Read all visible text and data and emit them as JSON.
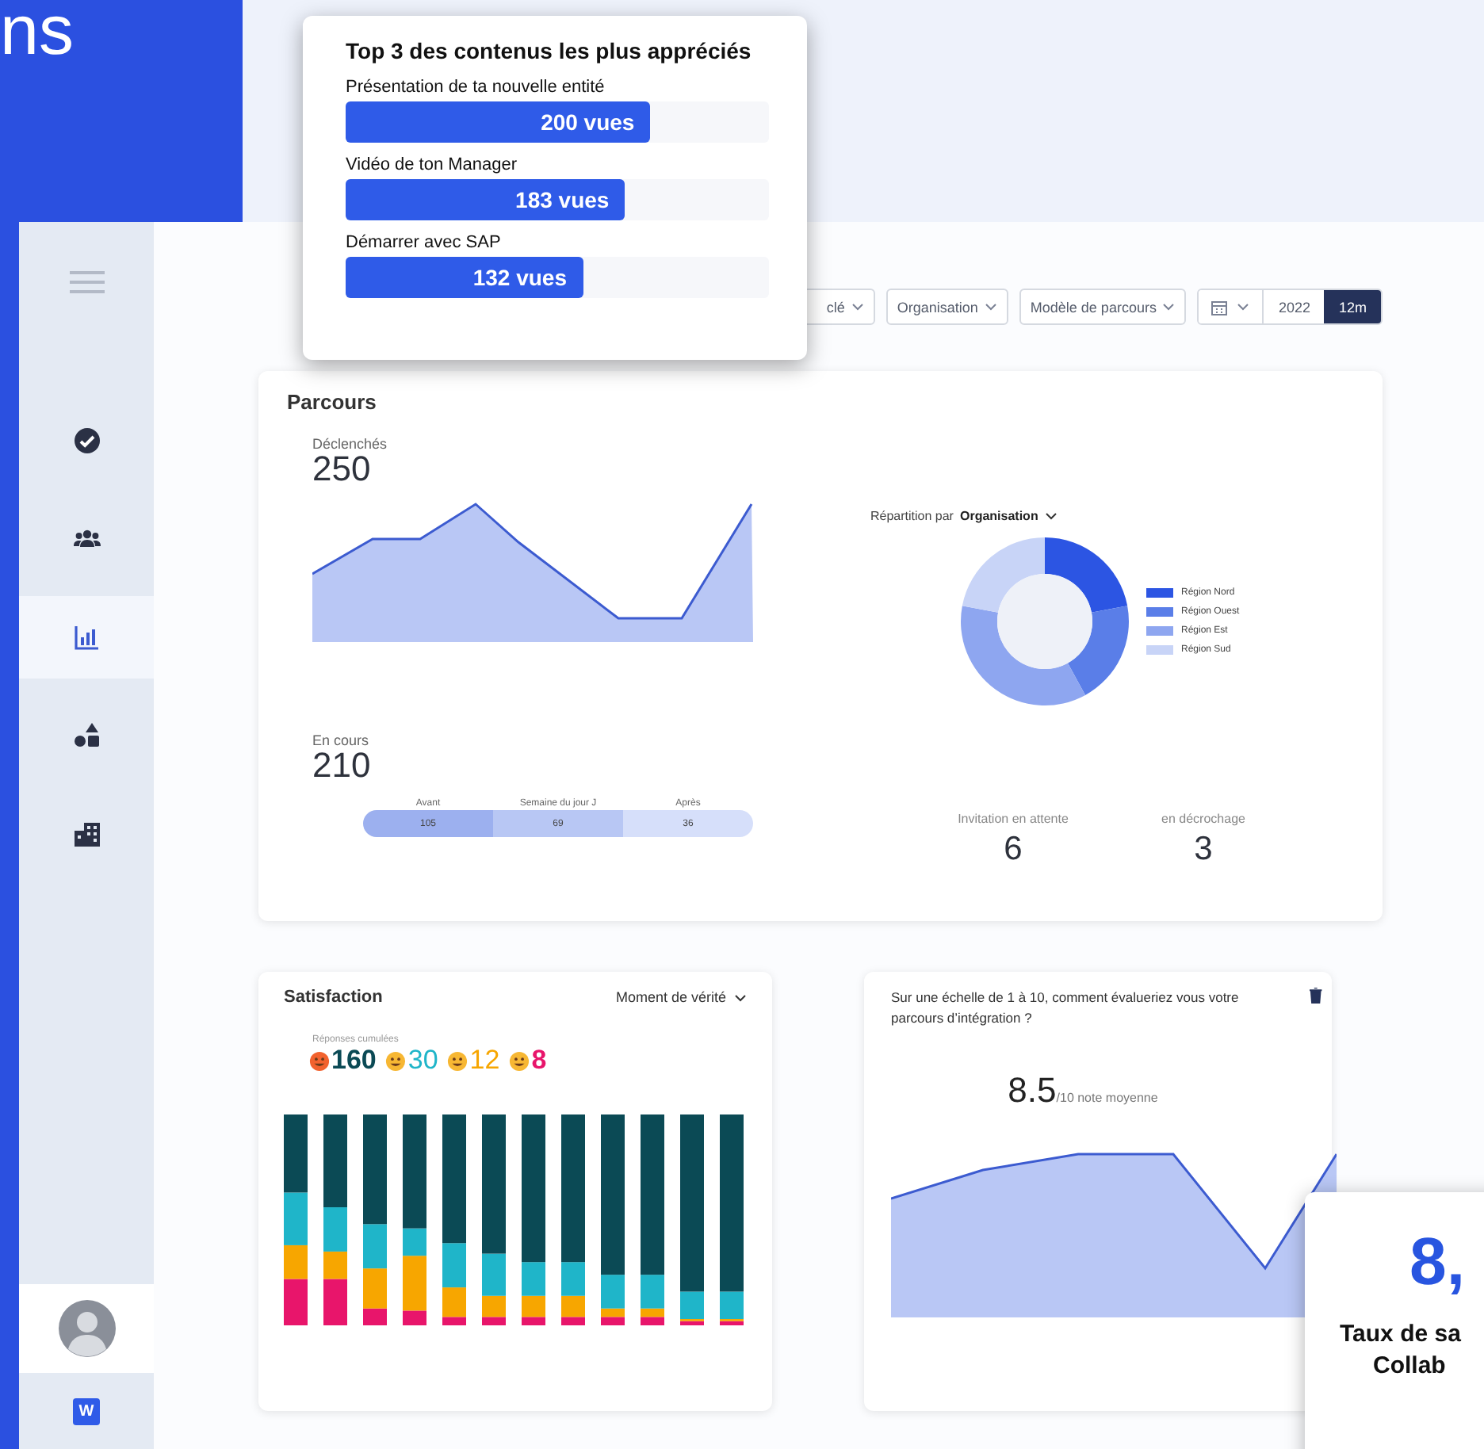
{
  "backdrop": {
    "heading_fragment": "ns"
  },
  "top_content": {
    "title": "Top 3 des contenus les plus appréciés",
    "items": [
      {
        "label": "Présentation de ta nouvelle entité",
        "value": "200 vues",
        "level": 0.72
      },
      {
        "label": "Vidéo de ton Manager",
        "value": "183 vues",
        "level": 0.66
      },
      {
        "label": "Démarrer avec SAP",
        "value": "132 vues",
        "level": 0.56
      }
    ]
  },
  "sidebar": {
    "items": [
      {
        "kind": "check",
        "selected": false
      },
      {
        "kind": "people",
        "selected": false
      },
      {
        "kind": "chart",
        "selected": true
      },
      {
        "kind": "shapes",
        "selected": false
      },
      {
        "kind": "building",
        "selected": false
      }
    ],
    "workspace_letter": "W"
  },
  "filters": {
    "chips": [
      "clé",
      "Organisation",
      "Modèle de parcours"
    ],
    "periods": [
      {
        "label": "2022",
        "selected": false
      },
      {
        "label": "12m",
        "selected": true
      }
    ]
  },
  "parcours": {
    "title": "Parcours",
    "triggered": {
      "label": "Déclenchés",
      "value": "250"
    },
    "breakdown": {
      "label": "Répartition par",
      "dimension": "Organisation",
      "legend": [
        {
          "label": "Région Nord",
          "color": "#2c55e3"
        },
        {
          "label": "Région Ouest",
          "color": "#5a7ee8"
        },
        {
          "label": "Région Est",
          "color": "#8ea6f0"
        },
        {
          "label": "Région Sud",
          "color": "#c8d4f7"
        }
      ]
    },
    "in_progress": {
      "label": "En cours",
      "value": "210",
      "segments": [
        {
          "label": "Avant",
          "value": "105",
          "color": "#9cb0ef"
        },
        {
          "label": "Semaine du jour J",
          "value": "69",
          "color": "#b8c7f4"
        },
        {
          "label": "Après",
          "value": "36",
          "color": "#d6dffa"
        }
      ]
    },
    "stats": [
      {
        "label": "Invitation en attente",
        "value": "6"
      },
      {
        "label": "en décrochage",
        "value": "3"
      }
    ]
  },
  "satisfaction": {
    "title": "Satisfaction",
    "filter": "Moment de vérité",
    "responses_label": "Réponses cumulées",
    "counts": [
      {
        "value": "160",
        "color": "#0b4a55"
      },
      {
        "value": "30",
        "color": "#1fb5c9"
      },
      {
        "value": "12",
        "color": "#f7a600"
      },
      {
        "value": "8",
        "color": "#e8156b"
      }
    ]
  },
  "question": {
    "text": "Sur une échelle de 1 à 10, comment évalueriez vous votre parcours d’intégration ?",
    "score": "8.5",
    "score_suffix": "/10 note moyenne"
  },
  "score_card": {
    "value": "8,",
    "lines": [
      "Taux de sa",
      "Collab"
    ]
  }
}
